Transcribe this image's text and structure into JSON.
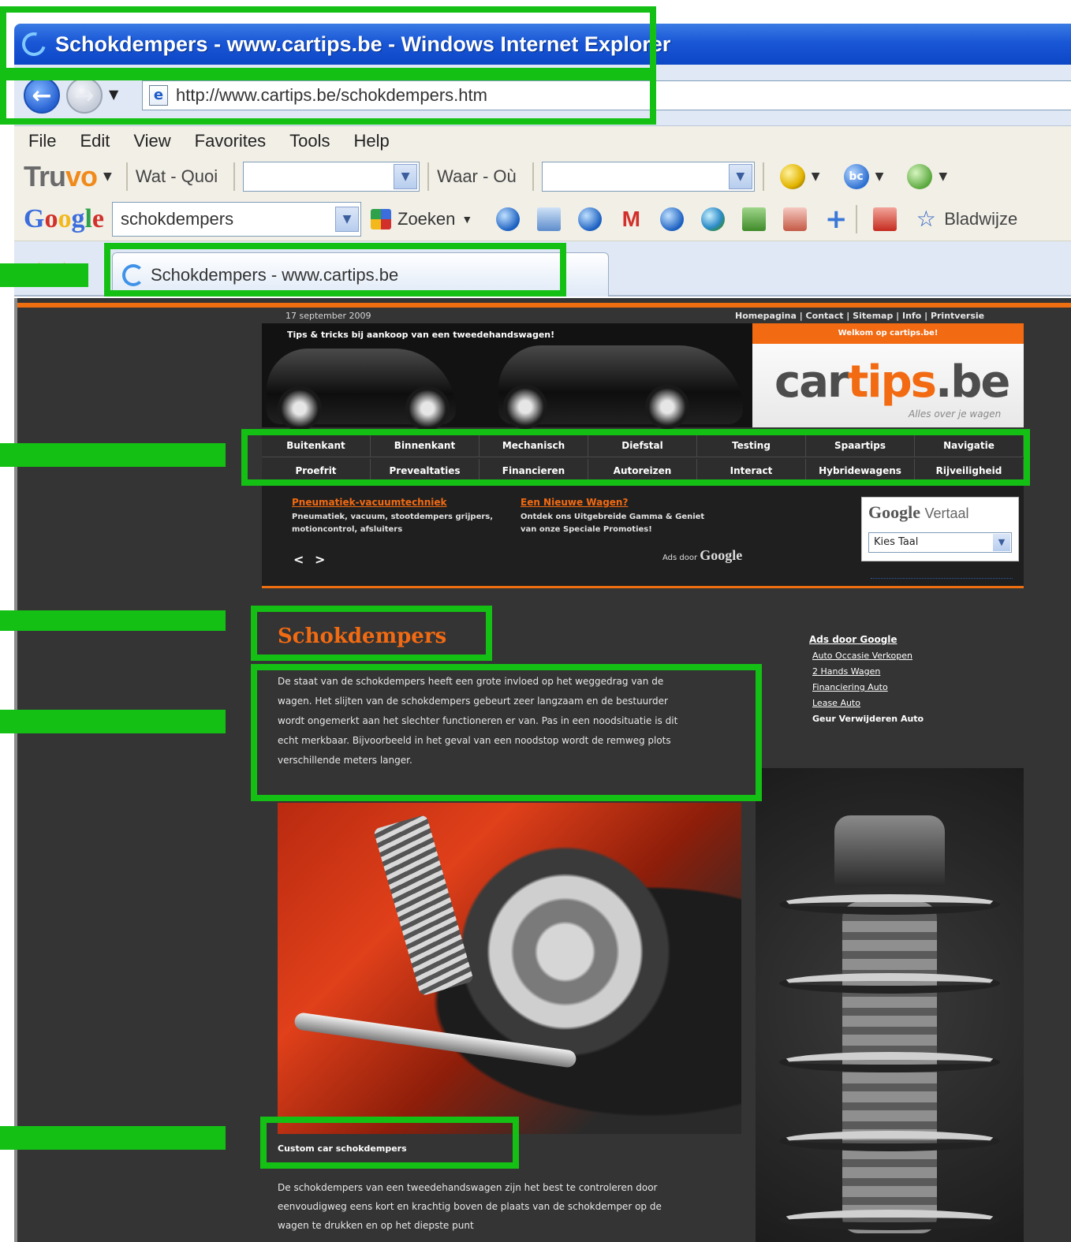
{
  "window": {
    "title": "Schokdempers - www.cartips.be - Windows Internet Explorer",
    "url": "http://www.cartips.be/schokdempers.htm"
  },
  "menu": [
    "File",
    "Edit",
    "View",
    "Favorites",
    "Tools",
    "Help"
  ],
  "truvo_toolbar": {
    "logo_a": "Tru",
    "logo_b": "vo",
    "what_label": "Wat - Quoi",
    "where_label": "Waar - Où"
  },
  "google_toolbar": {
    "logo": [
      "G",
      "o",
      "o",
      "g",
      "l",
      "e"
    ],
    "search_value": "schokdempers",
    "search_button": "Zoeken",
    "gmail_icon_text": "M",
    "bookmarks_label": "Bladwijze"
  },
  "tab": {
    "title": "Schokdempers - www.cartips.be"
  },
  "page": {
    "date": "17 september 2009",
    "top_links": "Homepagina | Contact | Sitemap | Info | Printversie",
    "tagline": "Tips & tricks bij aankoop van een tweedehandswagen!",
    "welcome": "Welkom op cartips.be!",
    "logo": {
      "car": "car",
      "tips": "tips",
      "be": ".be",
      "sub": "Alles over je wagen"
    },
    "nav_row1": [
      "Buitenkant",
      "Binnenkant",
      "Mechanisch",
      "Diefstal",
      "Testing",
      "Spaartips",
      "Navigatie"
    ],
    "nav_row2": [
      "Proefrit",
      "Prevealtaties",
      "Financieren",
      "Autoreizen",
      "Interact",
      "Hybridewagens",
      "Rijveiligheid"
    ],
    "ads": [
      {
        "title": "Pneumatiek-vacuumtechniek",
        "text": "Pneumatiek, vacuum, stootdempers grijpers, motioncontrol, afsluiters"
      },
      {
        "title": "Een Nieuwe Wagen?",
        "text": "Ontdek ons Uitgebreide Gamma & Geniet van onze Speciale Promoties!"
      }
    ],
    "ad_nav": "< >",
    "ads_by": "Ads door",
    "ads_by_brand": "Google",
    "translate": {
      "brand": "Google",
      "label": "Vertaal",
      "select_value": "Kies Taal"
    },
    "title": "Schokdempers",
    "intro": "De staat van de schokdempers heeft een grote invloed op het weggedrag van de wagen. Het slijten van de schokdempers gebeurt zeer langzaam en de bestuurder wordt ongemerkt aan het slechter functioneren er van. Pas in een noodsituatie is dit echt merkbaar. Bijvoorbeeld in het geval van een noodstop wordt de remweg plots verschillende meters langer.",
    "side_ads": {
      "heading": "Ads door Google",
      "links": [
        "Auto Occasie Verkopen",
        "2 Hands Wagen",
        "Financiering Auto",
        "Lease Auto"
      ],
      "plain": "Geur Verwijderen Auto"
    },
    "caption": "Custom car schokdempers",
    "body2": "De schokdempers van een tweedehandswagen zijn het best te controleren door eenvoudigweg eens kort en krachtig boven de plaats van de schokdemper op de wagen te drukken en op het diepste punt"
  },
  "annotation_color": "#15c015",
  "accent_color": "#f26a12"
}
